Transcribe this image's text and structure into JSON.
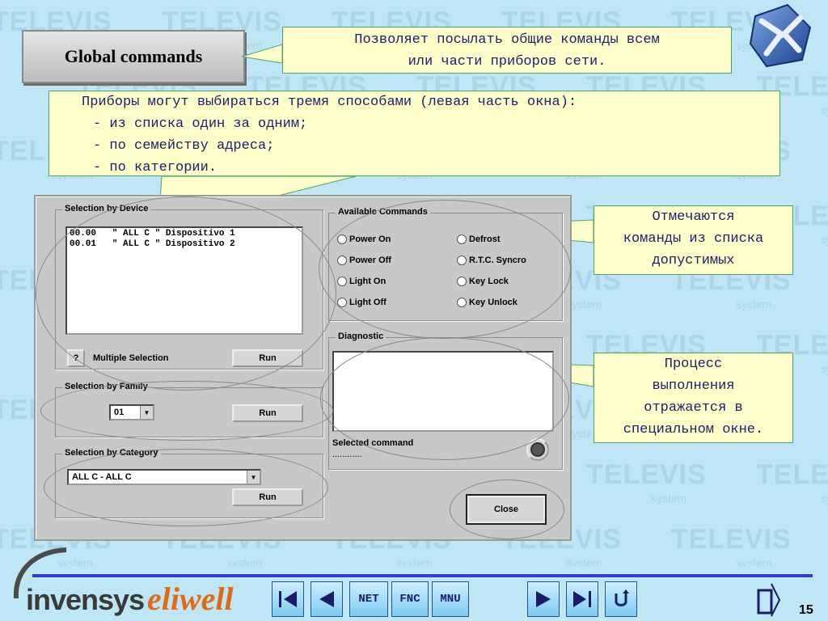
{
  "slide": {
    "title": "Global commands",
    "page_number": "15",
    "watermark_brand": "TELEVIS",
    "watermark_sub": "system"
  },
  "callouts": {
    "top": {
      "line1": "Позволяет посылать общие команды всем",
      "line2": "или части приборов сети."
    },
    "selection": {
      "line1": "Приборы могут выбираться тремя способами (левая часть окна):",
      "line2": "- из списка один за одним;",
      "line3": "- по семейству адреса;",
      "line4": "- по категории."
    },
    "commands": {
      "line1": "Отмечаются",
      "line2": "команды из списка",
      "line3": "допустимых"
    },
    "diagnostic": {
      "line1": "Процесс",
      "line2": "выполнения",
      "line3": "отражается в",
      "line4": "специальном окне."
    }
  },
  "dialog": {
    "selection_by_device": {
      "legend": "Selection by Device",
      "items": [
        "00.00   \" ALL C \" Dispositivo 1",
        "00.01   \" ALL C \" Dispositivo 2"
      ],
      "help_button": "?",
      "multiple_selection_label": "Multiple Selection",
      "run_button": "Run"
    },
    "selection_by_family": {
      "legend": "Selection by Family",
      "selected": "01",
      "run_button": "Run"
    },
    "selection_by_category": {
      "legend": "Selection by Category",
      "selected": "ALL C - ALL C",
      "run_button": "Run"
    },
    "available_commands": {
      "legend": "Available Commands",
      "left": [
        "Power On",
        "Power Off",
        "Light On",
        "Light Off"
      ],
      "right": [
        "Defrost",
        "R.T.C. Syncro",
        "Key Lock",
        "Key Unlock"
      ]
    },
    "diagnostic": {
      "legend": "Diagnostic",
      "selected_command_label": "Selected command",
      "selected_command_value": "............"
    },
    "close_button": "Close"
  },
  "footer": {
    "brand_left": "invensys",
    "brand_right": "eliwell",
    "nav": {
      "net": "NET",
      "fnc": "FNC",
      "mnu": "MNU"
    }
  }
}
